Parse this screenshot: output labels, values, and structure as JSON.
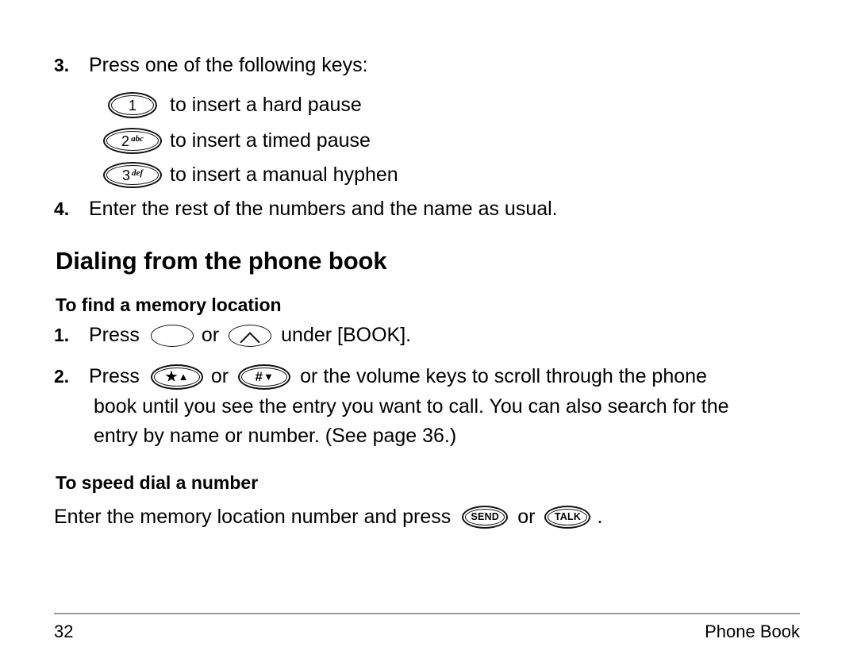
{
  "page": {
    "number": "32",
    "section": "Phone Book"
  },
  "steps_top": [
    {
      "marker": "3.",
      "text": "Press one of the following keys:"
    },
    {
      "marker": "4.",
      "text": "Enter the rest of the numbers and the name as usual."
    }
  ],
  "key_list": [
    {
      "key_digit": "1",
      "key_sub": "",
      "description": "to insert a hard pause"
    },
    {
      "key_digit": "2",
      "key_sub": "abc",
      "description": "to insert a timed pause"
    },
    {
      "key_digit": "3",
      "key_sub": "def",
      "description": "to insert a manual hyphen"
    }
  ],
  "section_heading": "Dialing from the phone book",
  "subsection_find": {
    "heading": "To find a memory location",
    "step1": {
      "marker": "1.",
      "before": "Press",
      "or": "or",
      "after": "under [BOOK].",
      "left_soft_key": "left-soft-key",
      "right_soft_key": "right-soft-key"
    },
    "step2": {
      "marker": "2.",
      "before": "Press",
      "or": "or",
      "star_key_symbol": "★",
      "star_key_arrow": "▲",
      "pound_key_symbol": "#",
      "pound_key_arrow": "▼",
      "line1_tail": "or the volume keys to scroll through the phone",
      "line2": "book until you see the entry you want to call. You can also search for the",
      "line3": "entry by name or number. (See page 36.)"
    }
  },
  "subsection_speed": {
    "heading": "To speed dial a number",
    "before": "Enter the memory location number and press",
    "send_label": "SEND",
    "or": "or",
    "talk_label": "TALK",
    "period": "."
  },
  "colors": {
    "text": "#000000",
    "rule": "#9a9a9a",
    "background": "#ffffff"
  }
}
